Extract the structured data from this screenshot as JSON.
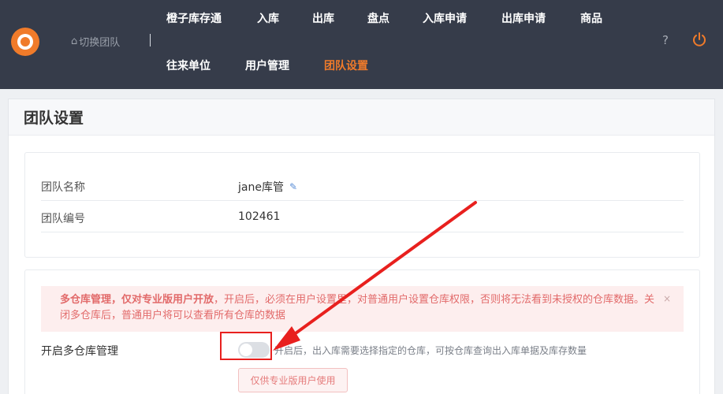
{
  "topnav": {
    "switch_team": "切换团队",
    "items": [
      "橙子库存通",
      "入库",
      "出库",
      "盘点",
      "入库申请",
      "出库申请",
      "商品",
      "往来单位",
      "用户管理",
      "团队设置"
    ],
    "active": "团队设置",
    "help": "?"
  },
  "page": {
    "title": "团队设置"
  },
  "team_info": {
    "name_label": "团队名称",
    "name_value": "jane库管",
    "id_label": "团队编号",
    "id_value": "102461"
  },
  "multi_warehouse": {
    "alert_bold": "多仓库管理，仅对专业版用户开放",
    "alert_text": "，开启后，必须在用户设置里，对普通用户设置仓库权限，否则将无法看到未授权的仓库数据。关闭多仓库后，普通用户将可以查看所有仓库的数据",
    "alert_close": "×",
    "setting_label": "开启多仓库管理",
    "toggle_on": false,
    "setting_desc": "开启后，出入库需要选择指定的仓库，可按仓库查询出入库单据及库存数量",
    "pro_button": "仅供专业版用户使用"
  },
  "colors": {
    "topbar": "#363c4a",
    "accent": "#f07b2a",
    "alert_bg": "#fdeeee",
    "alert_text": "#e26a6a",
    "annotation": "#e8201e"
  },
  "icons": [
    "logo",
    "home-icon",
    "edit-icon",
    "help-icon",
    "power-icon",
    "close-icon"
  ]
}
